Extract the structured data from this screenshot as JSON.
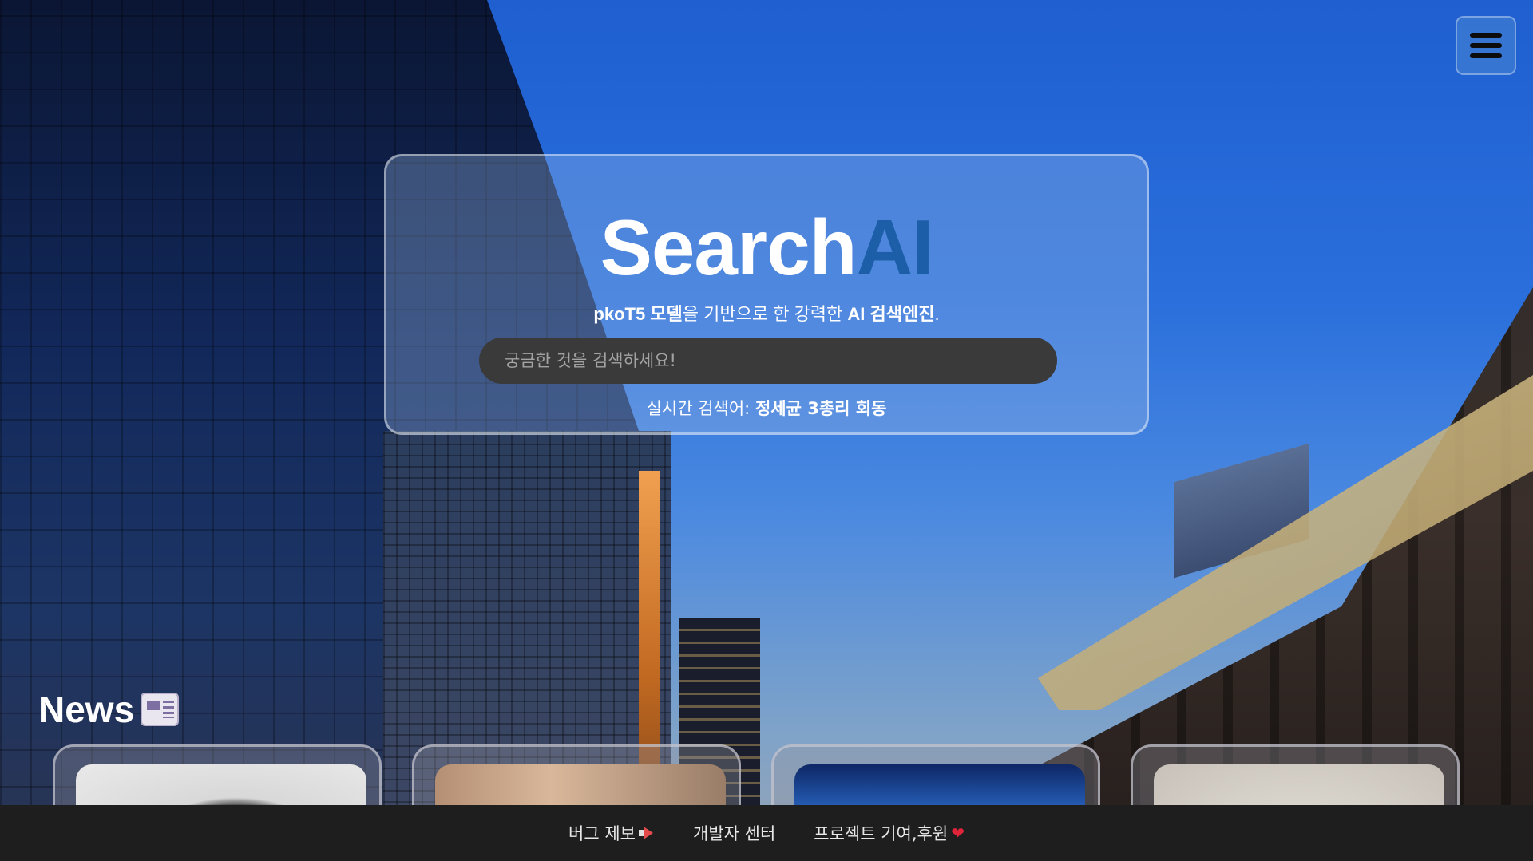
{
  "header": {
    "menu_icon": "hamburger-menu-icon"
  },
  "search": {
    "logo_part1": "Search",
    "logo_part2": "AI",
    "tagline_model": "pkoT5 모델",
    "tagline_middle": "을 기반으로 한 강력한 ",
    "tagline_engine": "AI 검색엔진",
    "tagline_end": ".",
    "placeholder": "궁금한 것을 검색하세요!",
    "value": "",
    "trending_label": "실시간 검색어: ",
    "trending_value": "정세균 3총리 회동"
  },
  "news": {
    "title": "News",
    "icon": "newspaper-icon",
    "cards": [
      {
        "thumb": "news-thumbnail-1"
      },
      {
        "thumb": "news-thumbnail-2"
      },
      {
        "thumb": "news-thumbnail-3"
      },
      {
        "thumb": "news-thumbnail-4"
      }
    ]
  },
  "footer": {
    "links": [
      {
        "label": "버그 제보",
        "icon": "megaphone-icon"
      },
      {
        "label": "개발자 센터"
      },
      {
        "label": "프로젝트 기여,후원",
        "icon": "heart-icon"
      }
    ]
  },
  "colors": {
    "logo_accent": "#1c5fa8",
    "search_box_bg": "#3a3a3a",
    "footer_bg": "#1e1e1e"
  }
}
